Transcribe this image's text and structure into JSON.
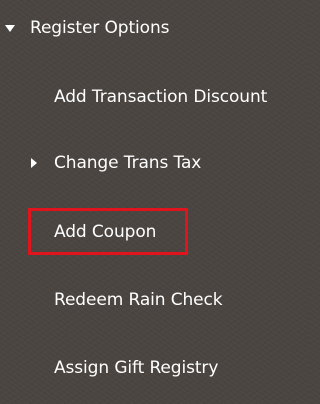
{
  "menu": {
    "section_label": "Register Options",
    "items": [
      {
        "label": "Add Transaction Discount"
      },
      {
        "label": "Change Trans Tax"
      },
      {
        "label": "Add Coupon"
      },
      {
        "label": "Redeem Rain Check"
      },
      {
        "label": "Assign Gift Registry"
      }
    ]
  },
  "highlight_color": "#e0141c"
}
